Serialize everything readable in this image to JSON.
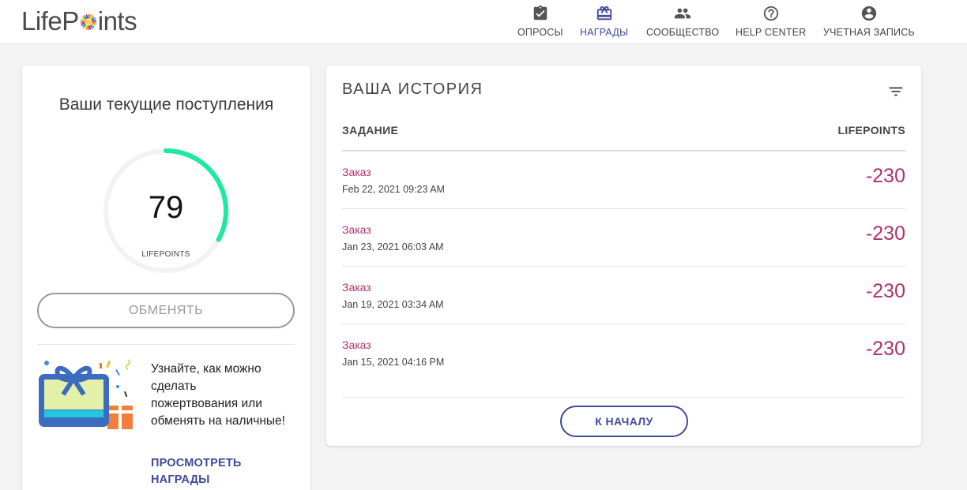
{
  "header": {
    "logo": {
      "part1": "Life",
      "part2": "Points"
    },
    "nav": [
      {
        "label": "ОПРОСЫ",
        "icon": "clipboard-check-icon"
      },
      {
        "label": "НАГРАДЫ",
        "icon": "gift-icon",
        "active": true
      },
      {
        "label": "СООБЩЕСТВО",
        "icon": "people-icon"
      },
      {
        "label": "HELP CENTER",
        "icon": "help-circle-icon"
      },
      {
        "label": "УЧЕТНАЯ ЗАПИСЬ",
        "icon": "account-circle-icon"
      }
    ]
  },
  "balance": {
    "title": "Ваши текущие поступления",
    "value": "79",
    "unit": "LIFEPOINTS",
    "progress": 0.33,
    "redeem_label": "ОБМЕНЯТЬ"
  },
  "promo": {
    "text": "Узнайте, как можно сделать пожертвования или обменять на наличные!",
    "link": "ПРОСМОТРЕТЬ НАГРАДЫ",
    "icon": "gift-card-icon"
  },
  "history": {
    "title": "ВАША ИСТОРИЯ",
    "col_task": "ЗАДАНИЕ",
    "col_points": "LIFEPOINTS",
    "rows": [
      {
        "task": "Заказ",
        "date": "Feb 22, 2021 09:23 AM",
        "points": "-230"
      },
      {
        "task": "Заказ",
        "date": "Jan 23, 2021 06:03 AM",
        "points": "-230"
      },
      {
        "task": "Заказ",
        "date": "Jan 19, 2021 03:34 AM",
        "points": "-230"
      },
      {
        "task": "Заказ",
        "date": "Jan 15, 2021 04:16 PM",
        "points": "-230"
      }
    ],
    "top_button": "К НАЧАЛУ"
  },
  "colors": {
    "accent": "#3f4a9b",
    "points": "#b2306c",
    "gauge": "#1de9a0"
  }
}
